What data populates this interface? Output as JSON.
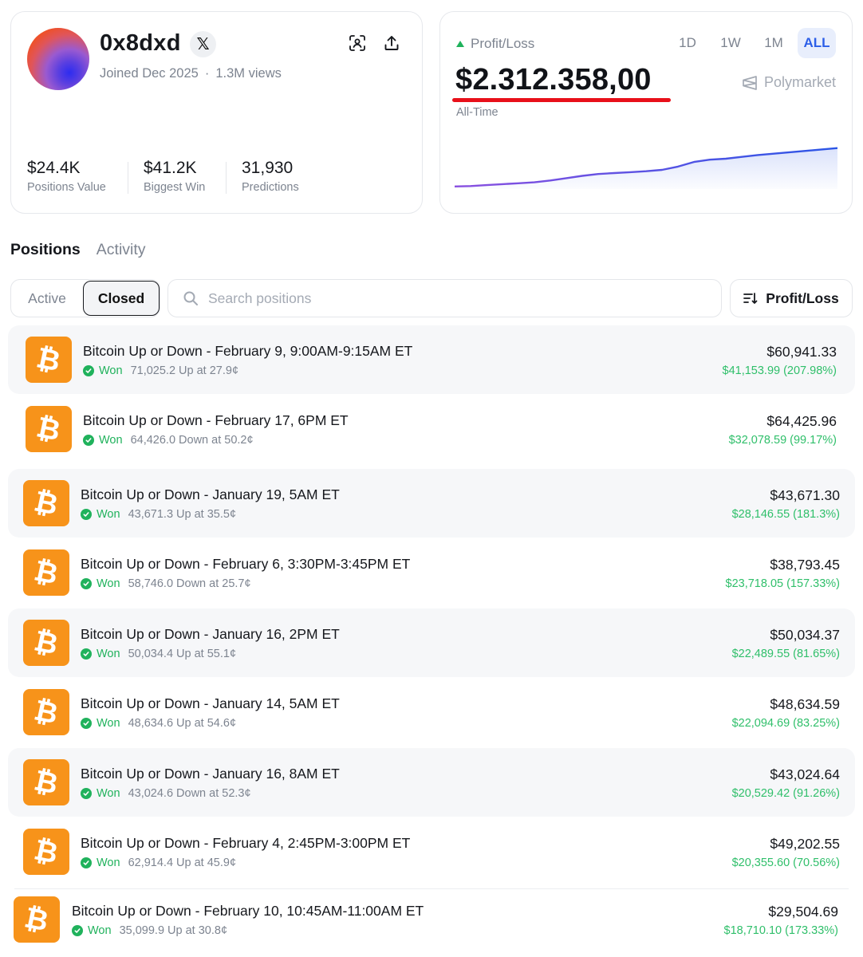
{
  "profile": {
    "username": "0x8dxd",
    "joined": "Joined Dec 2025",
    "separator": "·",
    "views": "1.3M views",
    "stats": [
      {
        "value": "$24.4K",
        "label": "Positions Value"
      },
      {
        "value": "$41.2K",
        "label": "Biggest Win"
      },
      {
        "value": "31,930",
        "label": "Predictions"
      }
    ]
  },
  "pnl": {
    "label": "Profit/Loss",
    "value": "$2.312.358,00",
    "period_label": "All-Time",
    "source": "Polymarket",
    "ranges": [
      "1D",
      "1W",
      "1M",
      "ALL"
    ],
    "active_range": "ALL",
    "chart_data": {
      "type": "area",
      "series": [
        {
          "values": [
            0.02,
            0.03,
            0.05,
            0.07,
            0.09,
            0.11,
            0.15,
            0.2,
            0.25,
            0.29,
            0.31,
            0.33,
            0.35,
            0.38,
            0.45,
            0.55,
            0.6,
            0.62,
            0.66,
            0.7,
            0.73,
            0.76,
            0.79,
            0.82,
            0.85
          ]
        }
      ],
      "colors": {
        "line_start": "#8a4fe0",
        "line_end": "#2a55e6",
        "fill": "#d9e1fb"
      }
    }
  },
  "tabs": [
    {
      "label": "Positions",
      "active": true
    },
    {
      "label": "Activity",
      "active": false
    }
  ],
  "filters": {
    "active_label": "Active",
    "closed_label": "Closed",
    "search_placeholder": "Search positions",
    "sort_label": "Profit/Loss"
  },
  "status_label": "Won",
  "positions": [
    {
      "title": "Bitcoin Up or Down - February 9, 9:00AM-9:15AM ET",
      "detail": "71,025.2 Up at 27.9¢",
      "amount": "$60,941.33",
      "gain": "$41,153.99 (207.98%)"
    },
    {
      "title": "Bitcoin Up or Down - February 17, 6PM ET",
      "detail": "64,426.0 Down at 50.2¢",
      "amount": "$64,425.96",
      "gain": "$32,078.59 (99.17%)"
    },
    {
      "title": "Bitcoin Up or Down - January 19, 5AM ET",
      "detail": "43,671.3 Up at 35.5¢",
      "amount": "$43,671.30",
      "gain": "$28,146.55 (181.3%)"
    },
    {
      "title": "Bitcoin Up or Down - February 6, 3:30PM-3:45PM ET",
      "detail": "58,746.0 Down at 25.7¢",
      "amount": "$38,793.45",
      "gain": "$23,718.05 (157.33%)"
    },
    {
      "title": "Bitcoin Up or Down - January 16, 2PM ET",
      "detail": "50,034.4 Up at 55.1¢",
      "amount": "$50,034.37",
      "gain": "$22,489.55 (81.65%)"
    },
    {
      "title": "Bitcoin Up or Down - January 14, 5AM ET",
      "detail": "48,634.6 Up at 54.6¢",
      "amount": "$48,634.59",
      "gain": "$22,094.69 (83.25%)"
    },
    {
      "title": "Bitcoin Up or Down - January 16, 8AM ET",
      "detail": "43,024.6 Down at 52.3¢",
      "amount": "$43,024.64",
      "gain": "$20,529.42 (91.26%)"
    },
    {
      "title": "Bitcoin Up or Down - February 4, 2:45PM-3:00PM ET",
      "detail": "62,914.4 Up at 45.9¢",
      "amount": "$49,202.55",
      "gain": "$20,355.60 (70.56%)"
    },
    {
      "title": "Bitcoin Up or Down - February 10, 10:45AM-11:00AM ET",
      "detail": "35,099.9 Up at 30.8¢",
      "amount": "$29,504.69",
      "gain": "$18,710.10 (173.33%)"
    }
  ],
  "icons": {
    "x": "x-logo-icon",
    "scan": "scan-icon",
    "share": "share-icon",
    "search": "search-icon",
    "sort": "sort-icon",
    "coin": "bitcoin-icon",
    "check": "check-circle-icon",
    "polymarket": "polymarket-logo-icon"
  },
  "colors": {
    "accent": "#2d5fe8",
    "gain": "#2fbf6a",
    "won": "#20b25c",
    "bitcoin": "#f7931a",
    "underline": "#e8101a"
  }
}
